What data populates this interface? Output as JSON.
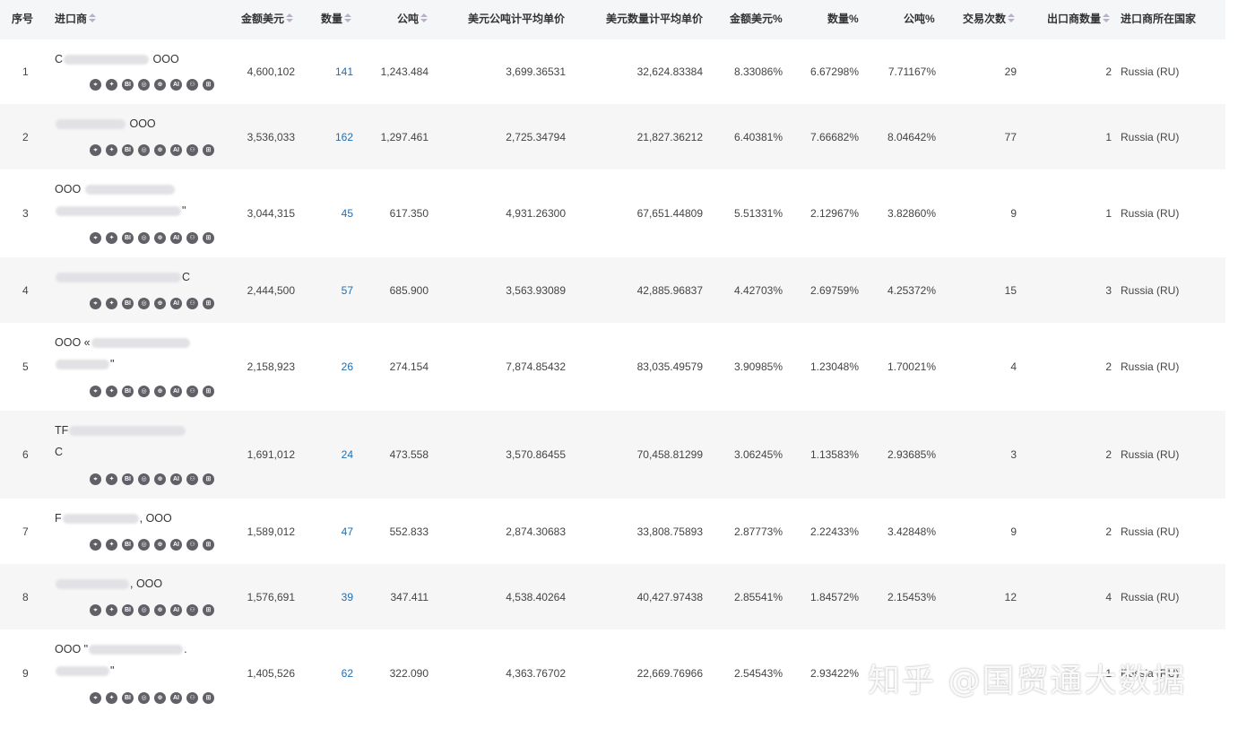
{
  "columns": [
    "序号",
    "进口商",
    "金额美元",
    "数量",
    "公吨",
    "美元公吨计平均单价",
    "美元数量计平均单价",
    "金额美元%",
    "数量%",
    "公吨%",
    "交易次数",
    "出口商数量",
    "进口商所在国家"
  ],
  "icons": [
    "target-icon",
    "compass-icon",
    "bi-icon",
    "circle-icon",
    "globe-icon",
    "ai-icon",
    "people-icon",
    "grid-globe-icon"
  ],
  "rows": [
    {
      "idx": "1",
      "line1_pre": "C",
      "line1_post": " OOO",
      "line2_pre": "",
      "line2_post": "",
      "amount": "4,600,102",
      "qty": "141",
      "tons": "1,243.484",
      "avg_ton": "3,699.36531",
      "avg_qty": "32,624.83384",
      "amount_pct": "8.33086%",
      "qty_pct": "6.67298%",
      "ton_pct": "7.71167%",
      "trades": "29",
      "exporters": "2",
      "country": "Russia (RU)"
    },
    {
      "idx": "2",
      "line1_pre": "",
      "line1_post": " OOO",
      "line2_pre": "",
      "line2_post": "",
      "amount": "3,536,033",
      "qty": "162",
      "tons": "1,297.461",
      "avg_ton": "2,725.34794",
      "avg_qty": "21,827.36212",
      "amount_pct": "6.40381%",
      "qty_pct": "7.66682%",
      "ton_pct": "8.04642%",
      "trades": "77",
      "exporters": "1",
      "country": "Russia (RU)"
    },
    {
      "idx": "3",
      "line1_pre": "OOO ",
      "line1_post": "",
      "line2_pre": "",
      "line2_post": "\"",
      "amount": "3,044,315",
      "qty": "45",
      "tons": "617.350",
      "avg_ton": "4,931.26300",
      "avg_qty": "67,651.44809",
      "amount_pct": "5.51331%",
      "qty_pct": "2.12967%",
      "ton_pct": "3.82860%",
      "trades": "9",
      "exporters": "1",
      "country": "Russia (RU)"
    },
    {
      "idx": "4",
      "line1_pre": "",
      "line1_post": "C",
      "line2_pre": "",
      "line2_post": "",
      "amount": "2,444,500",
      "qty": "57",
      "tons": "685.900",
      "avg_ton": "3,563.93089",
      "avg_qty": "42,885.96837",
      "amount_pct": "4.42703%",
      "qty_pct": "2.69759%",
      "ton_pct": "4.25372%",
      "trades": "15",
      "exporters": "3",
      "country": "Russia (RU)"
    },
    {
      "idx": "5",
      "line1_pre": "OOO «",
      "line1_post": "",
      "line2_pre": "",
      "line2_post": "\"",
      "amount": "2,158,923",
      "qty": "26",
      "tons": "274.154",
      "avg_ton": "7,874.85432",
      "avg_qty": "83,035.49579",
      "amount_pct": "3.90985%",
      "qty_pct": "1.23048%",
      "ton_pct": "1.70021%",
      "trades": "4",
      "exporters": "2",
      "country": "Russia (RU)"
    },
    {
      "idx": "6",
      "line1_pre": "TF",
      "line1_post": "",
      "line2_pre": "C",
      "line2_post": "",
      "amount": "1,691,012",
      "qty": "24",
      "tons": "473.558",
      "avg_ton": "3,570.86455",
      "avg_qty": "70,458.81299",
      "amount_pct": "3.06245%",
      "qty_pct": "1.13583%",
      "ton_pct": "2.93685%",
      "trades": "3",
      "exporters": "2",
      "country": "Russia (RU)"
    },
    {
      "idx": "7",
      "line1_pre": "F",
      "line1_post": ", OOO",
      "line2_pre": "",
      "line2_post": "",
      "amount": "1,589,012",
      "qty": "47",
      "tons": "552.833",
      "avg_ton": "2,874.30683",
      "avg_qty": "33,808.75893",
      "amount_pct": "2.87773%",
      "qty_pct": "2.22433%",
      "ton_pct": "3.42848%",
      "trades": "9",
      "exporters": "2",
      "country": "Russia (RU)"
    },
    {
      "idx": "8",
      "line1_pre": "",
      "line1_post": ", OOO",
      "line2_pre": "",
      "line2_post": "",
      "amount": "1,576,691",
      "qty": "39",
      "tons": "347.411",
      "avg_ton": "4,538.40264",
      "avg_qty": "40,427.97438",
      "amount_pct": "2.85541%",
      "qty_pct": "1.84572%",
      "ton_pct": "2.15453%",
      "trades": "12",
      "exporters": "4",
      "country": "Russia (RU)"
    },
    {
      "idx": "9",
      "line1_pre": "OOO \"",
      "line1_post": ".",
      "line2_pre": "",
      "line2_post": "\"",
      "amount": "1,405,526",
      "qty": "62",
      "tons": "322.090",
      "avg_ton": "4,363.76702",
      "avg_qty": "22,669.76966",
      "amount_pct": "2.54543%",
      "qty_pct": "2.93422%",
      "ton_pct": "",
      "trades": "",
      "exporters": "1",
      "country": "Russia (RU)"
    }
  ],
  "watermark": "知乎 @国贸通大数据"
}
